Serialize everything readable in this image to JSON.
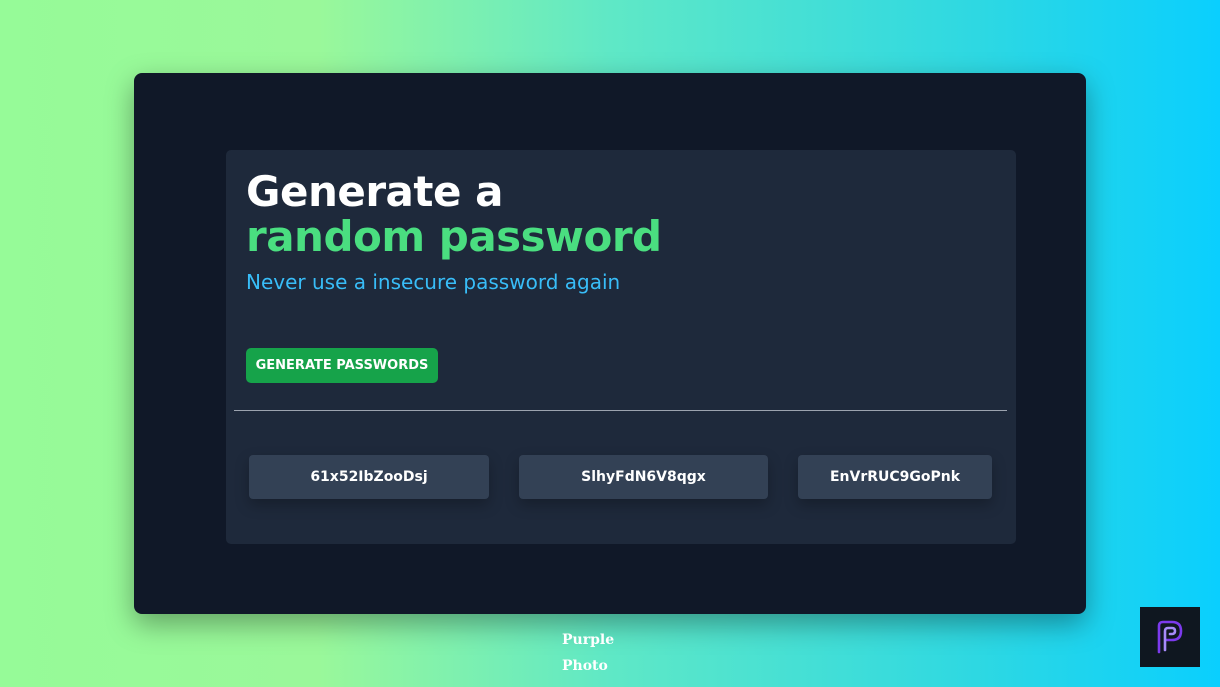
{
  "card": {
    "title_line1": "Generate a",
    "title_line2": "random password",
    "subtitle": "Never use a insecure password again",
    "generate_label": "GENERATE PASSWORDS",
    "passwords": [
      "61x52IbZooDsj",
      "SlhyFdN6V8qgx",
      "EnVrRUC9GoPnk"
    ]
  },
  "watermark": {
    "line1": "Purple",
    "line2": "Photo",
    "logo_icon": "purple-p-logo-icon"
  },
  "colors": {
    "accent_green": "#4ade80",
    "button_green": "#16a34a",
    "subtitle_blue": "#38bdf8",
    "outer_bg": "#101828",
    "inner_bg": "#1e293b",
    "password_box": "#334155",
    "logo_purple": "#7c3aed"
  }
}
